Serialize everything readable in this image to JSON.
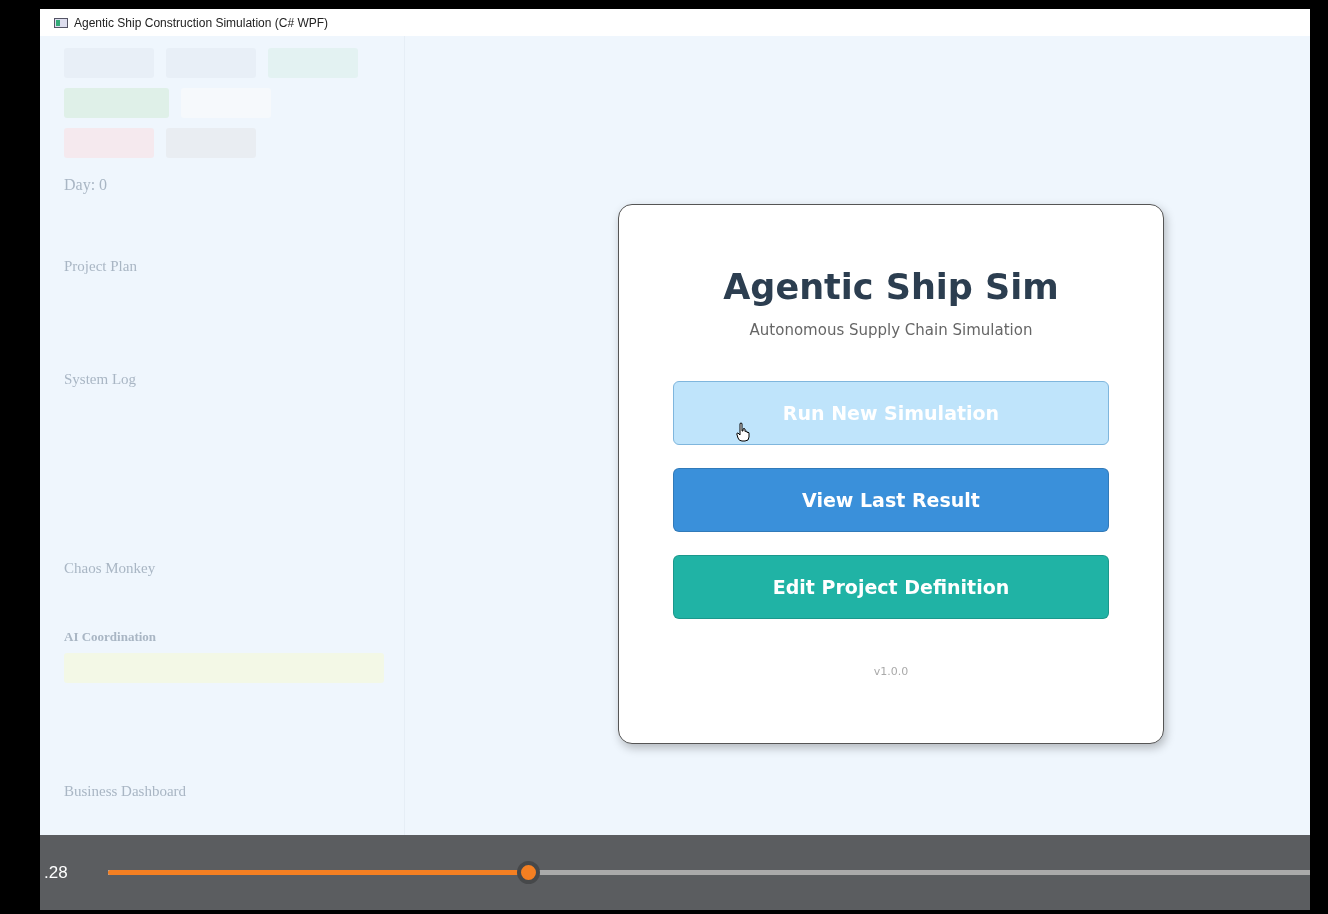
{
  "window": {
    "title": "Agentic Ship Construction Simulation (C# WPF)"
  },
  "background_panel": {
    "headings": [
      "Day: 0",
      "Project Plan",
      "System Log",
      "Chaos Monkey",
      "AI Coordination",
      "Business Dashboard"
    ]
  },
  "dialog": {
    "title": "Agentic Ship Sim",
    "subtitle": "Autonomous Supply Chain Simulation",
    "buttons": [
      {
        "label": "Run New Simulation",
        "color": "#bfe4fb",
        "hovered": true
      },
      {
        "label": "View Last Result",
        "color": "#3a90da",
        "hovered": false
      },
      {
        "label": "Edit Project Definition",
        "color": "#20b3a5",
        "hovered": false
      }
    ],
    "version": "v1.0.0"
  },
  "player": {
    "time": ".28",
    "level": 0.35
  }
}
